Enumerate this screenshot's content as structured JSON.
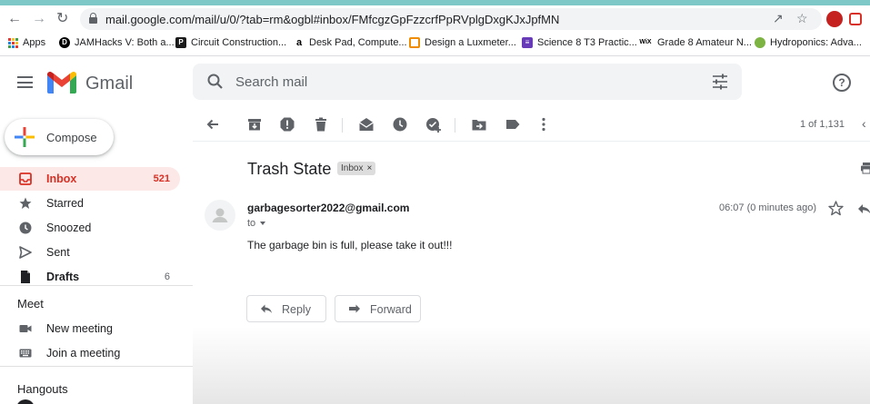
{
  "browser": {
    "url": "mail.google.com/mail/u/0/?tab=rm&ogbl#inbox/FMfcgzGpFzzcrfPpRVplgDxgKJxJpfMN",
    "bookmarks": [
      {
        "label": "Apps",
        "icon": "apps-grid-icon"
      },
      {
        "label": "JAMHacks V: Both a...",
        "icon": "jamhacks-icon"
      },
      {
        "label": "Circuit Construction...",
        "icon": "phet-icon"
      },
      {
        "label": "Desk Pad, Compute...",
        "icon": "amazon-icon"
      },
      {
        "label": "Design a Luxmeter...",
        "icon": "instructables-icon"
      },
      {
        "label": "Science 8 T3 Practic...",
        "icon": "forms-icon"
      },
      {
        "label": "Grade 8 Amateur N...",
        "icon": "wix-icon"
      },
      {
        "label": "Hydroponics: Adva...",
        "icon": "hydroponics-icon"
      }
    ]
  },
  "header": {
    "logo_text": "Gmail",
    "search_placeholder": "Search mail"
  },
  "sidebar": {
    "compose_label": "Compose",
    "items": [
      {
        "label": "Inbox",
        "count": "521",
        "icon": "inbox-icon"
      },
      {
        "label": "Starred",
        "count": "",
        "icon": "star-icon"
      },
      {
        "label": "Snoozed",
        "count": "",
        "icon": "clock-icon"
      },
      {
        "label": "Sent",
        "count": "",
        "icon": "send-icon"
      },
      {
        "label": "Drafts",
        "count": "6",
        "icon": "draft-icon"
      }
    ],
    "meet_title": "Meet",
    "meet_items": [
      {
        "label": "New meeting",
        "icon": "video-icon"
      },
      {
        "label": "Join a meeting",
        "icon": "keyboard-icon"
      }
    ],
    "hangouts_title": "Hangouts"
  },
  "toolbar": {
    "pager": "1 of 1,131"
  },
  "message": {
    "subject": "Trash State",
    "label": "Inbox",
    "sender": "garbagesorter2022@gmail.com",
    "to": "to",
    "time": "06:07 (0 minutes ago)",
    "body": "The garbage bin is full, please take it out!!!",
    "reply_label": "Reply",
    "forward_label": "Forward"
  },
  "colors": {
    "accent_red": "#d93025",
    "inbox_highlight": "#fce8e6",
    "search_bg": "#f1f3f4"
  }
}
